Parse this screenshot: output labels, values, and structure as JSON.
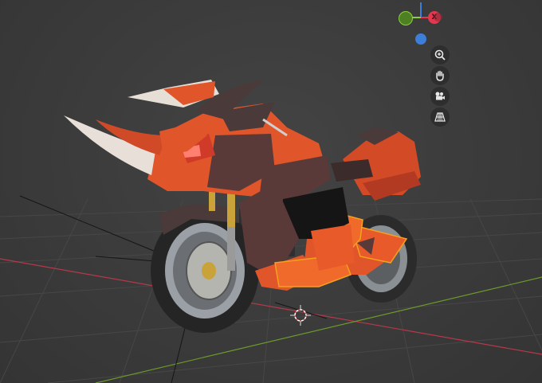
{
  "viewport": {
    "navigation_gizmo": {
      "x_axis_label": "X",
      "colors": {
        "x_axis": "#e5384f",
        "y_axis": "#8bd13a",
        "z_axis": "#3d7fd8"
      }
    },
    "tools": [
      {
        "name": "zoom",
        "icon": "zoom-in-icon"
      },
      {
        "name": "pan",
        "icon": "hand-icon"
      },
      {
        "name": "camera",
        "icon": "camera-icon"
      },
      {
        "name": "projection",
        "icon": "grid-perspective-icon"
      }
    ]
  },
  "colors": {
    "background": "#3a3a3a",
    "grid_line": "#4a4a4a",
    "x_axis_line": "#b7384a",
    "y_axis_line": "#6c9a2c",
    "selection_outline": "#f4a21c",
    "body_orange": "#e0552a",
    "body_dark": "#5a3a38",
    "fork_gold": "#c9a33a"
  }
}
